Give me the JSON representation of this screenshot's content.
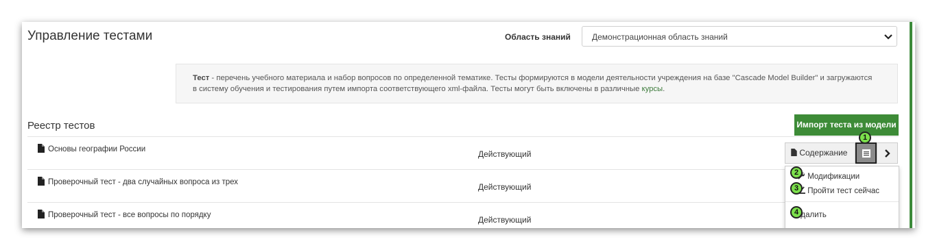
{
  "header": {
    "title": "Управление тестами",
    "area_label": "Область знаний",
    "area_value": "Демонстрационная область знаний"
  },
  "info": {
    "bold": "Тест",
    "text1": " - перечень учебного материала и набор вопросов по определенной тематике. Тесты формируются в модели деятельности учреждения на базе \"Cascade Model Builder\" и загружаются",
    "text2": "в систему обучения и тестирования путем импорта соответствующего xml-файла. Тесты могут быть включены в различные ",
    "link": "курсы",
    "text3": "."
  },
  "registry": {
    "title": "Реестр тестов",
    "import_label": "Импорт теста из модели",
    "content_label": "Содержание",
    "rows": [
      {
        "name": "Основы географии России",
        "status": "Действующий"
      },
      {
        "name": "Проверочный тест - два случайных вопроса из трех",
        "status": "Действующий"
      },
      {
        "name": "Проверочный тест - все вопросы по порядку",
        "status": "Действующий"
      }
    ]
  },
  "dropdown": {
    "items": [
      "Модификации",
      "Пройти тест сейчас",
      "Удалить"
    ]
  },
  "badges": [
    "1",
    "2",
    "3",
    "4"
  ],
  "colors": {
    "accent": "#3d8b37",
    "badge": "#7ce04c"
  }
}
